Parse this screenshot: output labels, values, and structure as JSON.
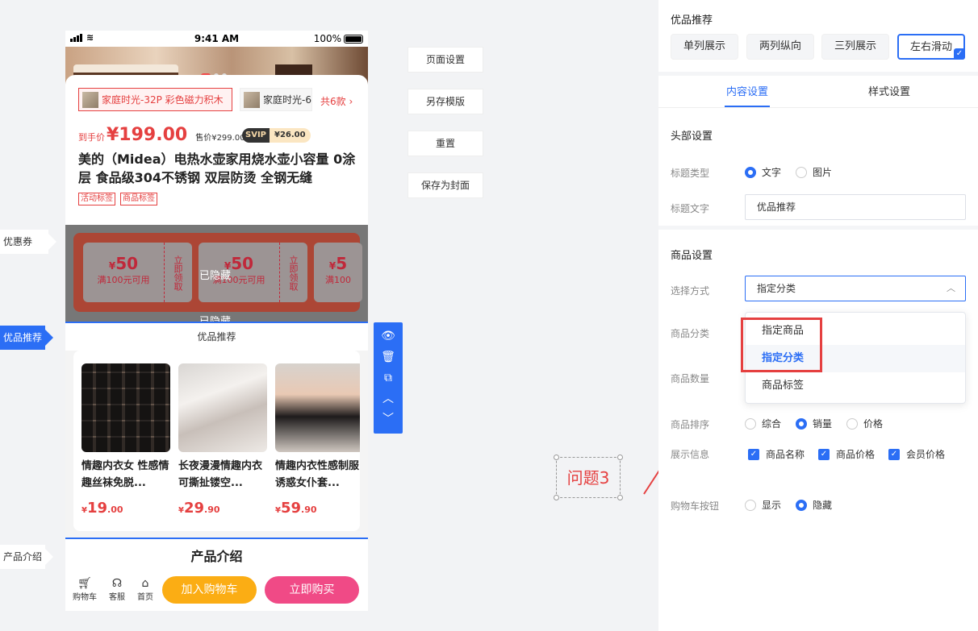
{
  "phone": {
    "status": {
      "time": "9:41 AM",
      "battery": "100%"
    },
    "sku_selected": "家庭时光-32P 彩色磁力积木",
    "sku_other": "家庭时光-6",
    "sku_more": "共6款",
    "price_label": "到手价",
    "price": "¥199.00",
    "orig_price": "售价¥299.00",
    "svip_label": "SVIP",
    "svip_price": "¥26.00",
    "product_title": "美的（Midea）电热水壶家用烧水壶小容量 0涂层 食品级304不锈钢 双层防烫 全钢无缝",
    "tags": [
      "活动标签",
      "商品标签"
    ],
    "coupons": [
      {
        "amount": "50",
        "cond": "满100元可用",
        "action": "立即领取"
      },
      {
        "amount": "50",
        "cond": "满100元可用",
        "action": "立即领取"
      },
      {
        "amount": "5",
        "cond": "满100"
      }
    ],
    "hidden_label_1": "已隐藏",
    "hidden_label_2": "已隐藏",
    "youpin_title": "优品推荐",
    "goods": [
      {
        "name": "情趣内衣女 性感情趣丝袜免脱...",
        "price_int": "19",
        "price_dec": ".00"
      },
      {
        "name": "长夜漫漫情趣内衣可撕扯镂空...",
        "price_int": "29",
        "price_dec": ".90"
      },
      {
        "name": "情趣内衣性感制服诱惑女仆套...",
        "price_int": "59",
        "price_dec": ".90"
      }
    ],
    "currency": "¥",
    "intro_title": "产品介绍",
    "bottom": {
      "cart": "购物车",
      "service": "客服",
      "home": "首页",
      "add_cart": "加入购物车",
      "buy_now": "立即购买"
    }
  },
  "side_labels": {
    "coupon": "优惠券",
    "youpin": "优品推荐",
    "intro": "产品介绍"
  },
  "actions": [
    "页面设置",
    "另存模版",
    "重置",
    "保存为封面"
  ],
  "annotation": "问题3",
  "panel": {
    "title": "优品推荐",
    "layouts": [
      "单列展示",
      "两列纵向",
      "三列展示",
      "左右滑动"
    ],
    "tabs": [
      "内容设置",
      "样式设置"
    ],
    "header_section": "头部设置",
    "title_type_label": "标题类型",
    "title_type_opts": [
      "文字",
      "图片"
    ],
    "title_text_label": "标题文字",
    "title_text_value": "优品推荐",
    "goods_section": "商品设置",
    "select_mode_label": "选择方式",
    "select_mode_value": "指定分类",
    "category_label": "商品分类",
    "count_label": "商品数量",
    "sort_label": "商品排序",
    "sort_opts": [
      "综合",
      "销量",
      "价格"
    ],
    "display_label": "展示信息",
    "display_opts": [
      "商品名称",
      "商品价格",
      "会员价格"
    ],
    "cart_btn_label": "购物车按钮",
    "cart_btn_opts": [
      "显示",
      "隐藏"
    ],
    "dropdown_opts": [
      "指定商品",
      "指定分类",
      "商品标签"
    ]
  },
  "colors": {
    "accent": "#2b6ef5",
    "price_red": "#e54040",
    "highlight": "#e54040"
  }
}
